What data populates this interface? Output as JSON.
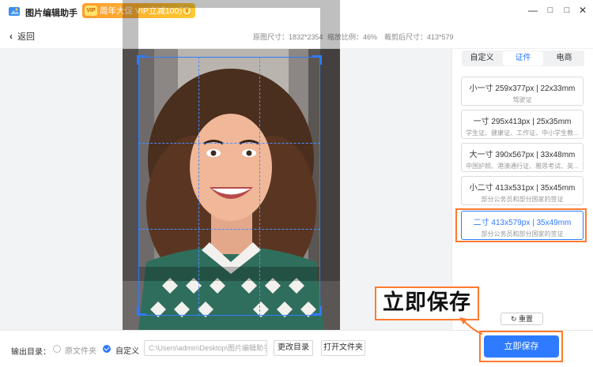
{
  "titlebar": {
    "app_title": "图片编辑助手",
    "promo_text": "周年大促 VIP立减100元",
    "promo_badge": "VIP",
    "promo_coin": "¥",
    "minimize": "—",
    "restore": "□",
    "maximize": "□",
    "close": "✕"
  },
  "subbar": {
    "back_label": "返回",
    "original_size": "原图尺寸：1832*2354",
    "zoom_ratio": "缩放比例：46%",
    "cropped_size": "裁剪后尺寸：413*579"
  },
  "tabs": [
    {
      "label": "自定义",
      "active": false
    },
    {
      "label": "证件",
      "active": true
    },
    {
      "label": "电商",
      "active": false
    }
  ],
  "sizes": [
    {
      "main": "小一寸 259x377px | 22x33mm",
      "sub": "驾驶证",
      "selected": false
    },
    {
      "main": "一寸 295x413px | 25x35mm",
      "sub": "学生证、健康证、工作证、中小学生教...",
      "selected": false
    },
    {
      "main": "大一寸 390x567px | 33x48mm",
      "sub": "中国护照、港澳通行证、雅思考试、英...",
      "selected": false
    },
    {
      "main": "小二寸 413x531px | 35x45mm",
      "sub": "部分公务员和部分国家的签证",
      "selected": false
    },
    {
      "main": "二寸 413x579px | 35x49mm",
      "sub": "部分公务员和部分国家的签证",
      "selected": true
    }
  ],
  "reset_label": "重置",
  "save_label": "立即保存",
  "callout_text": "立即保存",
  "output": {
    "label": "输出目录：",
    "option_original": "原文件夹",
    "option_custom": "自定义",
    "path_value": "C:\\Users\\admin\\Desktop\\图片编辑助手",
    "change_dir": "更改目录",
    "open_folder": "打开文件夹"
  },
  "colors": {
    "accent": "#2f7bff",
    "highlight": "#ff7a2e",
    "promo": "#ff9a2e"
  },
  "icons": [
    "app-logo-icon",
    "vip-icon",
    "coin-icon",
    "minimize-icon",
    "restore-icon",
    "maximize-icon",
    "close-icon",
    "back-chevron-icon",
    "reset-icon"
  ]
}
